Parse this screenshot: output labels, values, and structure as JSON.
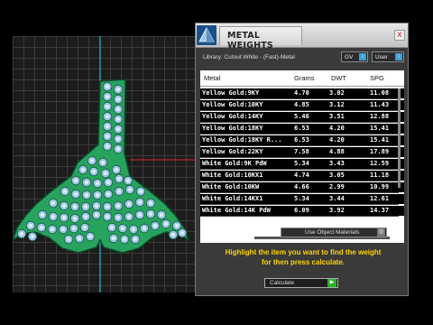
{
  "panel": {
    "title": "METAL WEIGHTS",
    "close_label": "x",
    "library_label": "Library: Cutout White - (Fast)-Metal",
    "toggles": [
      {
        "label": "GV",
        "indicator": "i"
      },
      {
        "label": "User",
        "indicator": "i"
      }
    ],
    "table": {
      "columns": [
        "Metal",
        "Grams",
        "DWT",
        "SPG"
      ],
      "rows": [
        {
          "metal": "Yellow Gold:9KY",
          "grams": "4.70",
          "dwt": "3.02",
          "spg": "11.08"
        },
        {
          "metal": "Yellow Gold:10KY",
          "grams": "4.85",
          "dwt": "3.12",
          "spg": "11.43"
        },
        {
          "metal": "Yellow Gold:14KY",
          "grams": "5.46",
          "dwt": "3.51",
          "spg": "12.88"
        },
        {
          "metal": "Yellow Gold:18KY",
          "grams": "6.53",
          "dwt": "4.20",
          "spg": "15.41"
        },
        {
          "metal": "Yellow Gold:18KY R...",
          "grams": "6.53",
          "dwt": "4.20",
          "spg": "15.41"
        },
        {
          "metal": "Yellow Gold:22KY",
          "grams": "7.58",
          "dwt": "4.88",
          "spg": "17.89"
        },
        {
          "metal": "White Gold:9K PdW",
          "grams": "5.34",
          "dwt": "3.43",
          "spg": "12.59"
        },
        {
          "metal": "White Gold:10KX1",
          "grams": "4.74",
          "dwt": "3.05",
          "spg": "11.18"
        },
        {
          "metal": "White Gold:10KW",
          "grams": "4.66",
          "dwt": "2.99",
          "spg": "10.99"
        },
        {
          "metal": "White Gold:14KX1",
          "grams": "5.34",
          "dwt": "3.44",
          "spg": "12.61"
        },
        {
          "metal": "White Gold:14K PdW",
          "grams": "6.09",
          "dwt": "3.92",
          "spg": "14.37"
        }
      ]
    },
    "use_object_materials": "Use Object Materials",
    "hint_line1": "Highlight the item you want to find the weight",
    "hint_line2": "for then press calculate.",
    "calculate_label": "Calculate",
    "colors": {
      "hint": "#ffd400",
      "indicator": "#3aa0d8",
      "calc_arrow": "#28b428"
    }
  },
  "viewport": {
    "model_color": "#27a35e",
    "gem_color": "#9fc4e8",
    "axis_colors": {
      "y": "#25c8e0",
      "x": "#e02525"
    }
  }
}
